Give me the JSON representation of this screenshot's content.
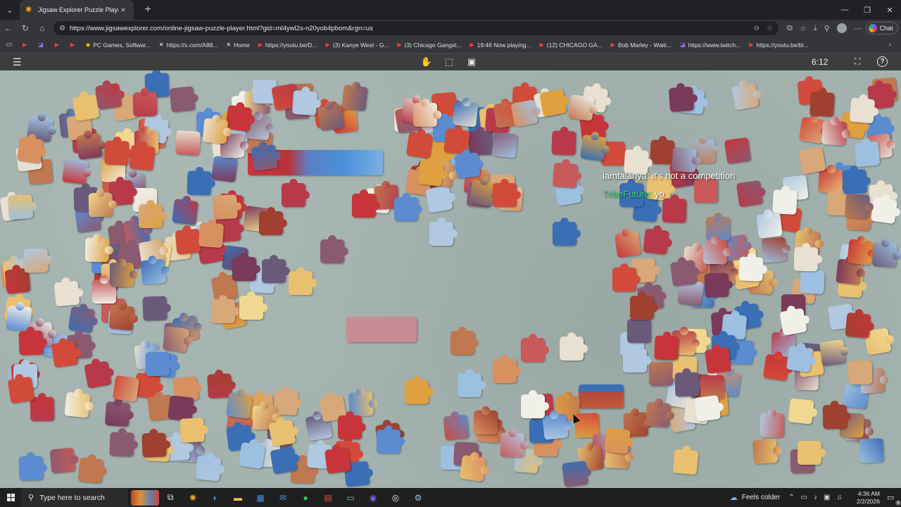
{
  "browser": {
    "tab_title": "Jigsaw Explorer Puzzle Player",
    "url": "https://www.jigsawexplorer.com/online-jigsaw-puzzle-player.html?gid=ml4ywl2s-n20yob4pbom&rgn=us",
    "chat_label": "Chat",
    "bookmarks": [
      {
        "icon": "youtube-icon",
        "label": ""
      },
      {
        "icon": "twitch-icon",
        "label": ""
      },
      {
        "icon": "youtube-icon",
        "label": ""
      },
      {
        "icon": "youtube-icon",
        "label": ""
      },
      {
        "icon": "pcgames-icon",
        "label": "PC Games, Softwar..."
      },
      {
        "icon": "x-icon",
        "label": "https://x.com/A88..."
      },
      {
        "icon": "x-icon",
        "label": "Home"
      },
      {
        "icon": "youtube-icon",
        "label": "https://youtu.be/D..."
      },
      {
        "icon": "youtube-icon",
        "label": "(3) Kanye West - G..."
      },
      {
        "icon": "youtube-icon",
        "label": "(3) Chicago Gangst..."
      },
      {
        "icon": "youtube-icon",
        "label": "19:46 Now playing..."
      },
      {
        "icon": "youtube-icon",
        "label": "(12) CHICAGO GA..."
      },
      {
        "icon": "youtube-icon",
        "label": "Bob Marley - Waiti..."
      },
      {
        "icon": "twitch-icon",
        "label": "https://www.twitch..."
      },
      {
        "icon": "youtube-icon",
        "label": "https://youtu.be/bl..."
      }
    ]
  },
  "puzzle": {
    "timer": "6:12",
    "accent_board": "#a3b2ae"
  },
  "chat_overlay": [
    {
      "user": "iamtalanya:",
      "message": "it's not a competition"
    },
    {
      "user": "TribeFuture:",
      "message": "yo"
    }
  ],
  "taskbar": {
    "search_placeholder": "Type here to search",
    "weather": "Feels colder",
    "time": "4:36 AM",
    "date": "2/2/2026",
    "notifications": "6"
  }
}
